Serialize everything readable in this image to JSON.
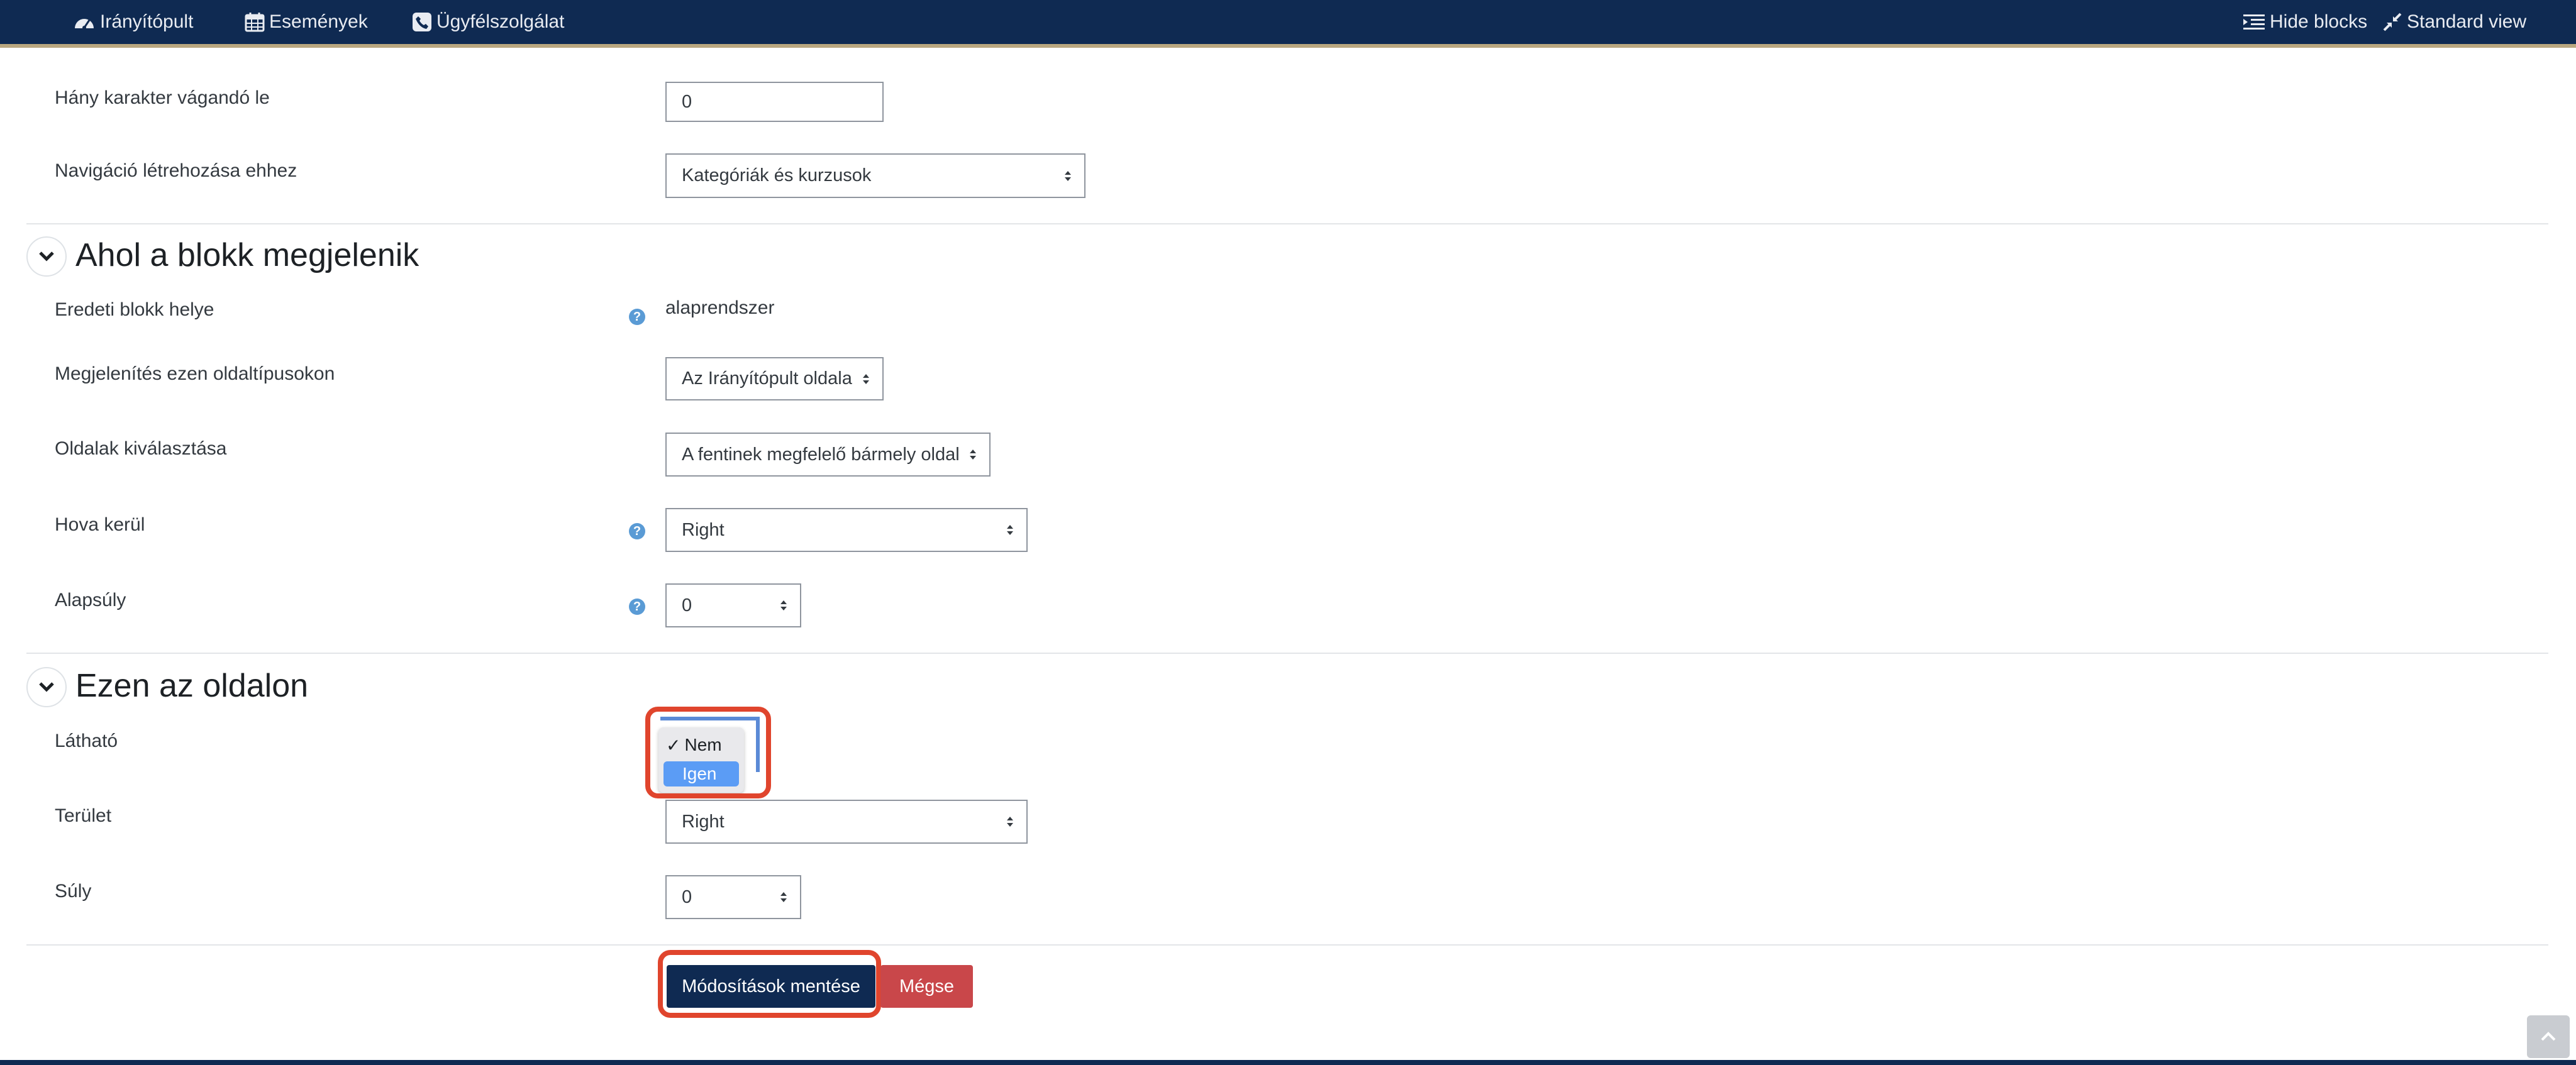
{
  "topbar": {
    "nav": [
      {
        "label": "Irányítópult",
        "icon": "dashboard-icon"
      },
      {
        "label": "Események",
        "icon": "calendar-icon"
      },
      {
        "label": "Ügyfélszolgálat",
        "icon": "phone-icon"
      }
    ],
    "hide_blocks": "Hide blocks",
    "standard_view": "Standard view"
  },
  "fields": {
    "truncate_label": "Hány karakter vágandó le",
    "truncate_value": "0",
    "nav_label": "Navigáció létrehozása ehhez",
    "nav_value": "Kategóriák és kurzusok"
  },
  "section_where": {
    "title": "Ahol a blokk megjelenik",
    "original_label": "Eredeti blokk helye",
    "original_value": "alaprendszer",
    "pagetypes_label": "Megjelenítés ezen oldaltípusokon",
    "pagetypes_value": "Az Irányítópult oldala",
    "pages_label": "Oldalak kiválasztása",
    "pages_value": "A fentinek megfelelő bármely oldal",
    "region_label": "Hova kerül",
    "region_value": "Right",
    "weight_label": "Alapsúly",
    "weight_value": "0"
  },
  "section_page": {
    "title": "Ezen az oldalon",
    "visible_label": "Látható",
    "visible_options": [
      {
        "label": "Nem",
        "checked": true
      },
      {
        "label": "Igen",
        "highlighted": true
      }
    ],
    "region_label": "Terület",
    "region_value": "Right",
    "weight_label": "Súly",
    "weight_value": "0"
  },
  "buttons": {
    "save": "Módosítások mentése",
    "cancel": "Mégse"
  },
  "colors": {
    "navbar": "#0f2a52",
    "primary_button": "#0f2a52",
    "cancel_button": "#c9474a",
    "highlight": "#e0452d",
    "help_icon": "#5a9bd5"
  }
}
